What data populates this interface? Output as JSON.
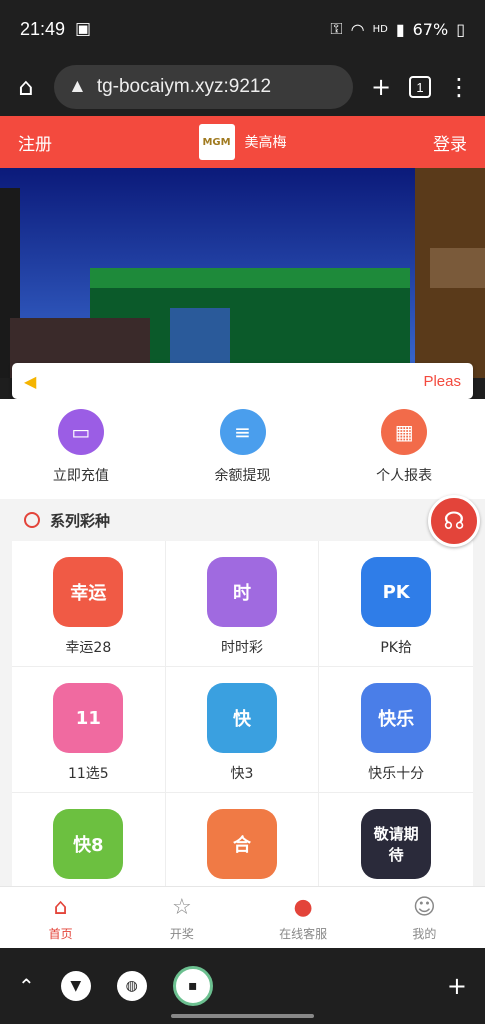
{
  "status": {
    "time": "21:49",
    "hd": "HD",
    "battery": "67%"
  },
  "browser": {
    "url": "tg-bocaiym.xyz:9212",
    "tab_count": "1",
    "home_icon": "home-icon",
    "plus_icon": "plus-icon"
  },
  "header": {
    "register": "注册",
    "brand": "美高梅",
    "logo_text": "MGM",
    "login": "登录"
  },
  "notice": {
    "text": "Pleas"
  },
  "quick": [
    {
      "label": "立即充值",
      "icon": "wallet-icon",
      "color": "#9b5de5"
    },
    {
      "label": "余额提现",
      "icon": "withdraw-icon",
      "color": "#4a9eed"
    },
    {
      "label": "个人报表",
      "icon": "calendar-icon",
      "color": "#f26b4a"
    }
  ],
  "section": {
    "title": "系列彩种"
  },
  "games": [
    {
      "label": "幸运28",
      "icon_text": "幸运",
      "color": "#f05a45"
    },
    {
      "label": "时时彩",
      "icon_text": "时",
      "color": "#a06ae0"
    },
    {
      "label": "PK拾",
      "icon_text": "PK",
      "color": "#2f7de8"
    },
    {
      "label": "11选5",
      "icon_text": "11",
      "color": "#f06aa0"
    },
    {
      "label": "快3",
      "icon_text": "快",
      "color": "#3aa0e0"
    },
    {
      "label": "快乐十分",
      "icon_text": "快乐",
      "color": "#4a7ee8"
    },
    {
      "label": "",
      "icon_text": "快8",
      "color": "#6cc040"
    },
    {
      "label": "",
      "icon_text": "合",
      "color": "#f07a45"
    },
    {
      "label": "",
      "icon_text": "敬请期待",
      "color": "#2a2a3a"
    }
  ],
  "tabs": [
    {
      "label": "首页",
      "icon": "home-icon"
    },
    {
      "label": "开奖",
      "icon": "badge-icon"
    },
    {
      "label": "在线客服",
      "icon": "bell-icon"
    },
    {
      "label": "我的",
      "icon": "user-icon"
    }
  ]
}
